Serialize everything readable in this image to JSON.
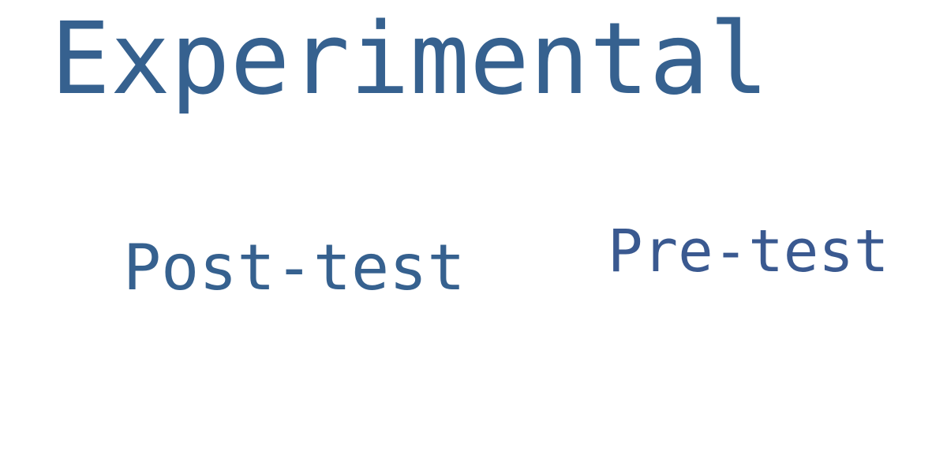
{
  "word_cloud": {
    "words": [
      {
        "text": "Experimental",
        "color": "#36618f"
      },
      {
        "text": "Post-test",
        "color": "#36618f"
      },
      {
        "text": "Pre-test",
        "color": "#3a5990"
      }
    ]
  }
}
